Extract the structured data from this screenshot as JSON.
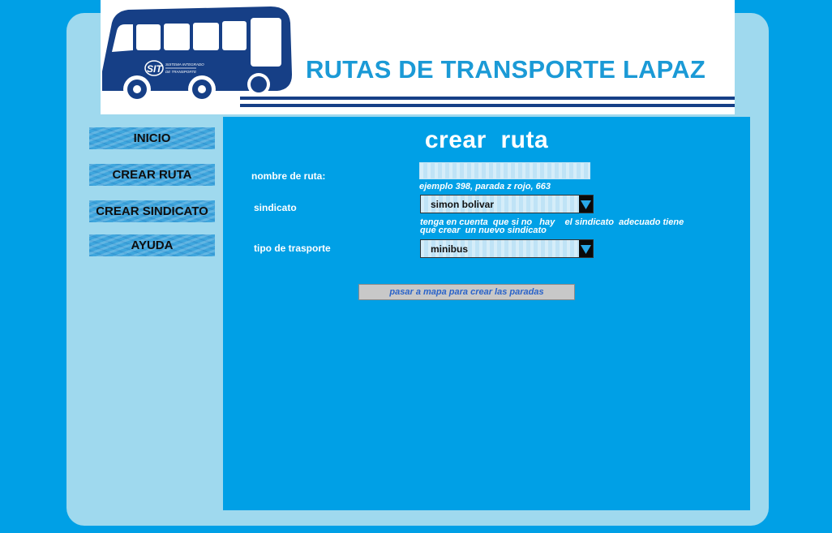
{
  "header": {
    "title": "RUTAS DE TRANSPORTE LAPAZ",
    "logo_text": "SIT",
    "logo_subtext_line1": "SISTEMA INTEGRADO",
    "logo_subtext_line2": "DE TRANSPORTE"
  },
  "menu": {
    "items": [
      {
        "label": "INICIO"
      },
      {
        "label": "CREAR RUTA"
      },
      {
        "label": "CREAR SINDICATO"
      },
      {
        "label": "AYUDA"
      }
    ]
  },
  "form": {
    "title": "crear  ruta",
    "route_name": {
      "label": "nombre de ruta:",
      "value": "",
      "hint": "ejemplo 398, parada z rojo, 663"
    },
    "sindicato": {
      "label": "sindicato",
      "selected": "simon bolivar",
      "hint_line1": "tenga en cuenta  que si no   hay    el sindicato  adecuado tiene",
      "hint_line2": "que crear  un nuevo sindicato"
    },
    "tipo": {
      "label": "tipo de trasporte",
      "selected": "minibus"
    },
    "submit_label": "pasar a mapa para crear las  paradas"
  },
  "colors": {
    "background": "#00a0e6",
    "shell": "#9fd9ee",
    "title_blue": "#1b9ad6",
    "logo_navy": "#163f86"
  }
}
